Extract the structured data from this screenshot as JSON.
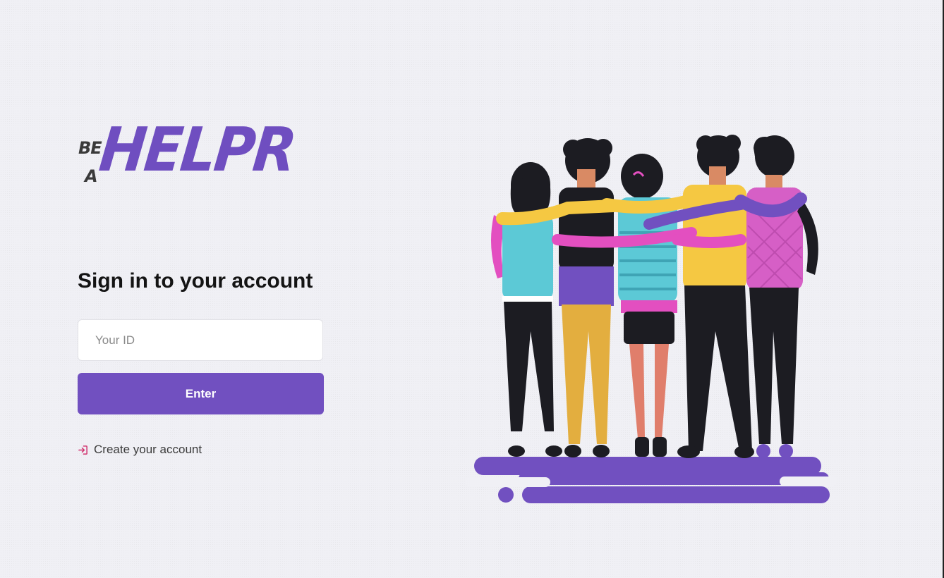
{
  "logo": {
    "small_top": "BE",
    "small_bottom": "A",
    "main": "HELPR"
  },
  "login": {
    "title": "Sign in to your account",
    "id_placeholder": "Your ID",
    "id_value": "",
    "enter_label": "Enter",
    "create_account_label": "Create your account"
  },
  "icons": {
    "create_account": "sign-in-arrow-icon"
  },
  "colors": {
    "accent": "#7150c0",
    "logo_purple": "#6f4ec0",
    "logo_dark": "#3a3a3a",
    "link_icon": "#d1336f",
    "title": "#141414"
  }
}
